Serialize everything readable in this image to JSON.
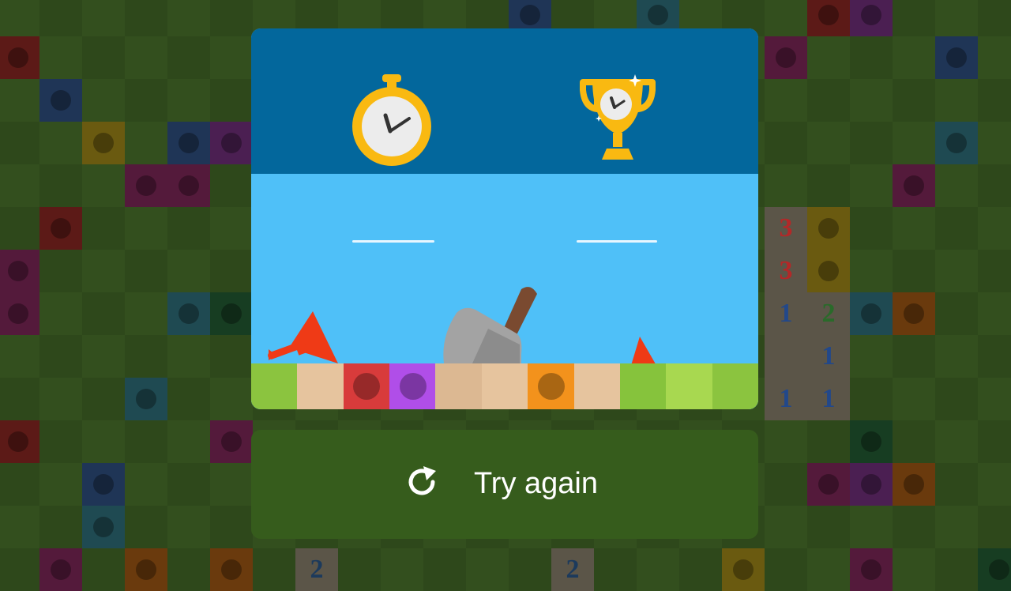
{
  "game": {
    "board_tiles": [
      {
        "col": 0,
        "row": 1,
        "color": "#5c1a17",
        "dot": true
      },
      {
        "col": 1,
        "row": 2,
        "color": "#1f3556",
        "dot": true
      },
      {
        "col": 2,
        "row": 3,
        "color": "#6a5a10",
        "dot": true
      },
      {
        "col": 4,
        "row": 3,
        "color": "#1f3556",
        "dot": true
      },
      {
        "col": 5,
        "row": 3,
        "color": "#4b1f52",
        "dot": true
      },
      {
        "col": 3,
        "row": 4,
        "color": "#541a3b",
        "dot": true
      },
      {
        "col": 4,
        "row": 4,
        "color": "#541a3b",
        "dot": true
      },
      {
        "col": 1,
        "row": 5,
        "color": "#5c1a17",
        "dot": true
      },
      {
        "col": 0,
        "row": 6,
        "color": "#541a3b",
        "dot": true
      },
      {
        "col": 0,
        "row": 7,
        "color": "#541a3b",
        "dot": true
      },
      {
        "col": 4,
        "row": 7,
        "color": "#1f4a52",
        "dot": true
      },
      {
        "col": 5,
        "row": 7,
        "color": "#173d22",
        "dot": true
      },
      {
        "col": 3,
        "row": 9,
        "color": "#1f4a52",
        "dot": true
      },
      {
        "col": 0,
        "row": 10,
        "color": "#5c1a17",
        "dot": true
      },
      {
        "col": 5,
        "row": 10,
        "color": "#541a3b",
        "dot": true
      },
      {
        "col": 2,
        "row": 11,
        "color": "#1f3556",
        "dot": true
      },
      {
        "col": 2,
        "row": 12,
        "color": "#1f4a52",
        "dot": true
      },
      {
        "col": 1,
        "row": 13,
        "color": "#541a3b",
        "dot": true
      },
      {
        "col": 3,
        "row": 13,
        "color": "#6a3a0d",
        "dot": true
      },
      {
        "col": 5,
        "row": 13,
        "color": "#6a3a0d",
        "dot": true
      },
      {
        "col": 12,
        "row": 0,
        "color": "#1f3556",
        "dot": true
      },
      {
        "col": 15,
        "row": 0,
        "color": "#1f4a52",
        "dot": true
      },
      {
        "col": 19,
        "row": 0,
        "color": "#5c1a17",
        "dot": true
      },
      {
        "col": 20,
        "row": 0,
        "color": "#4b1f52",
        "dot": true
      },
      {
        "col": 18,
        "row": 1,
        "color": "#541a3b",
        "dot": true
      },
      {
        "col": 22,
        "row": 1,
        "color": "#1f3556",
        "dot": true
      },
      {
        "col": 22,
        "row": 3,
        "color": "#1f4a52",
        "dot": true
      },
      {
        "col": 21,
        "row": 4,
        "color": "#541a3b",
        "dot": true
      },
      {
        "col": 18,
        "row": 5,
        "color": "#5b5548",
        "num": "3",
        "numColor": "#b32828"
      },
      {
        "col": 19,
        "row": 5,
        "color": "#6a5a10",
        "dot": true
      },
      {
        "col": 18,
        "row": 6,
        "color": "#5b5548",
        "num": "3",
        "numColor": "#b32828"
      },
      {
        "col": 19,
        "row": 6,
        "color": "#6a5a10",
        "dot": true
      },
      {
        "col": 18,
        "row": 7,
        "color": "#5b5548",
        "num": "1",
        "numColor": "#22488a"
      },
      {
        "col": 19,
        "row": 7,
        "color": "#5b5548",
        "num": "2",
        "numColor": "#2a6a2a"
      },
      {
        "col": 20,
        "row": 7,
        "color": "#1f4a52",
        "dot": true
      },
      {
        "col": 21,
        "row": 7,
        "color": "#6a3a0d",
        "dot": true
      },
      {
        "col": 18,
        "row": 8,
        "color": "#5b5548"
      },
      {
        "col": 19,
        "row": 8,
        "color": "#5b5548",
        "num": "1",
        "numColor": "#22488a"
      },
      {
        "col": 18,
        "row": 9,
        "color": "#5b5548",
        "num": "1",
        "numColor": "#22488a"
      },
      {
        "col": 19,
        "row": 9,
        "color": "#5b5548",
        "num": "1",
        "numColor": "#22488a"
      },
      {
        "col": 20,
        "row": 10,
        "color": "#173d22",
        "dot": true
      },
      {
        "col": 19,
        "row": 11,
        "color": "#541a3b",
        "dot": true
      },
      {
        "col": 20,
        "row": 11,
        "color": "#4b1f52",
        "dot": true
      },
      {
        "col": 21,
        "row": 11,
        "color": "#6a3a0d",
        "dot": true
      },
      {
        "col": 23,
        "row": 13,
        "color": "#173d22",
        "dot": true
      },
      {
        "col": 20,
        "row": 13,
        "color": "#541a3b",
        "dot": true
      },
      {
        "col": 17,
        "row": 13,
        "color": "#6a5a10",
        "dot": true
      },
      {
        "col": 7,
        "row": 13,
        "color": "#5b5548",
        "num": "2",
        "numColor": "#1c3a5c"
      },
      {
        "col": 13,
        "row": 13,
        "color": "#5b5548",
        "num": "2",
        "numColor": "#1c3a5c"
      }
    ],
    "ground_cells": [
      {
        "color": "#8bc43f",
        "dot": false
      },
      {
        "color": "#e6c49e",
        "dot": false
      },
      {
        "color": "#d83b3b",
        "dot": true
      },
      {
        "color": "#b04ee8",
        "dot": true
      },
      {
        "color": "#dcb892",
        "dot": false
      },
      {
        "color": "#e6c49e",
        "dot": false
      },
      {
        "color": "#f3921c",
        "dot": true
      },
      {
        "color": "#e6c49e",
        "dot": false
      },
      {
        "color": "#86c33c",
        "dot": false
      },
      {
        "color": "#a8d850",
        "dot": false
      },
      {
        "color": "#8bc43f",
        "dot": false
      }
    ]
  },
  "result": {
    "time_icon": "stopwatch-icon",
    "best_icon": "trophy-icon",
    "time_value": "",
    "best_value": ""
  },
  "actions": {
    "try_again_label": "Try again",
    "try_again_icon": "refresh-icon"
  },
  "colors": {
    "header": "#03679c",
    "sky": "#4fc0f8",
    "button": "#365c1c",
    "flag": "#ef3a16",
    "gold": "#f9b911"
  }
}
